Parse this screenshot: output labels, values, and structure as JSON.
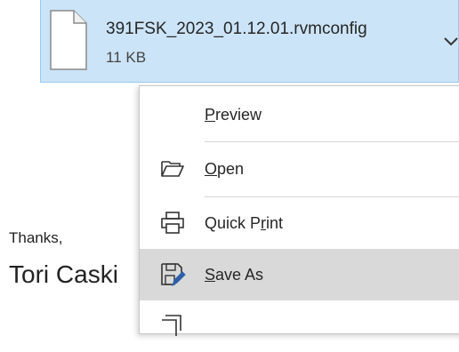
{
  "attachment": {
    "file_name": "391FSK_2023_01.12.01.rvmconfig",
    "file_size": "11 KB",
    "icon": "file-icon",
    "menu_icon": "chevron-down-icon"
  },
  "email_body": {
    "closing": "Thanks,",
    "signature": "Tori Caski"
  },
  "context_menu": {
    "items": [
      {
        "accel": "P",
        "rest": "review",
        "icon": null
      },
      {
        "accel": "O",
        "rest": "pen",
        "icon": "folder-open-icon"
      },
      {
        "before": "Quick P",
        "accel": "r",
        "rest": "int",
        "icon": "printer-icon"
      },
      {
        "accel": "S",
        "rest": "ave As",
        "icon": "save-as-icon",
        "highlighted": true
      }
    ]
  },
  "colors": {
    "attachment_bg": "#cce4f7",
    "attachment_border": "#99c9ef",
    "menu_hover": "#d9d9d9",
    "icon_accent": "#2b5fa8"
  }
}
